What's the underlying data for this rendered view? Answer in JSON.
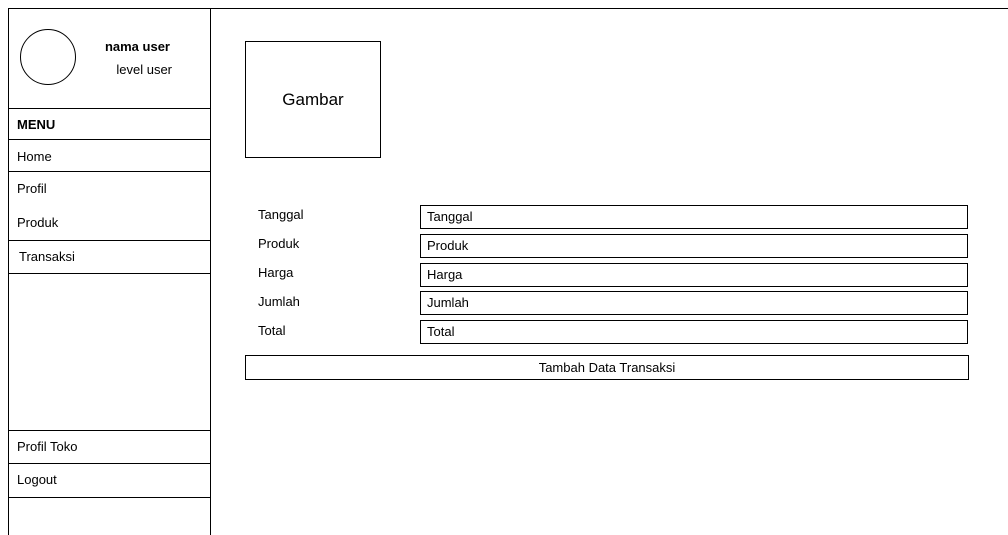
{
  "sidebar": {
    "user_name": "nama user",
    "user_level": "level user",
    "menu_title": "MENU",
    "items": [
      "Home",
      "Profil",
      "Produk",
      "Transaksi"
    ],
    "bottom_items": [
      "Profil Toko",
      "Logout"
    ]
  },
  "main": {
    "image_placeholder": "Gambar",
    "fields": [
      {
        "label": "Tanggal",
        "placeholder": "Tanggal"
      },
      {
        "label": "Produk",
        "placeholder": "Produk"
      },
      {
        "label": "Harga",
        "placeholder": "Harga"
      },
      {
        "label": "Jumlah",
        "placeholder": "Jumlah"
      },
      {
        "label": "Total",
        "placeholder": "Total"
      }
    ],
    "submit_label": "Tambah Data Transaksi"
  }
}
